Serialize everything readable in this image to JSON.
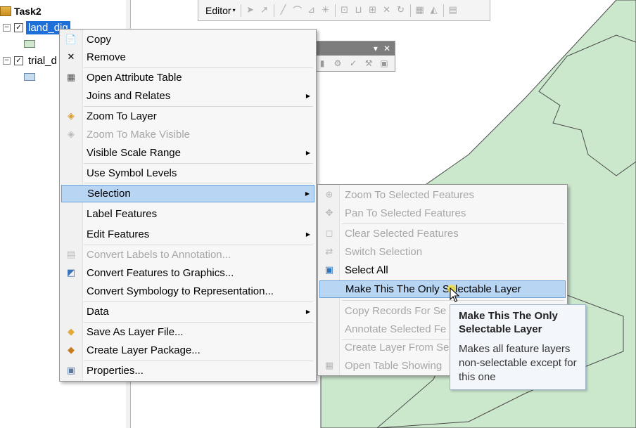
{
  "colors": {
    "map_fill": "#cbe8cd",
    "map_stroke": "#4a4a4a",
    "highlight": "#b8d6f3",
    "selected_layer": "#1e6fd9"
  },
  "toc": {
    "root": "Task2",
    "layers": [
      {
        "name": "land_dig",
        "checked": true,
        "swatch": "#cfe8cf"
      },
      {
        "name": "trial_d",
        "checked": true,
        "swatch": "#c6dcef"
      }
    ]
  },
  "editor_toolbar": {
    "label": "Editor"
  },
  "context_menu": {
    "items": [
      {
        "label": "Copy",
        "icon": "copy-icon",
        "glyph": "📄",
        "enabled": true,
        "submenu": false
      },
      {
        "label": "Remove",
        "icon": "remove-icon",
        "glyph": "✕",
        "enabled": true,
        "submenu": false
      },
      {
        "label": "Open Attribute Table",
        "icon": "table-icon",
        "glyph": "▦",
        "enabled": true,
        "submenu": false
      },
      {
        "label": "Joins and Relates",
        "icon": "",
        "glyph": "",
        "enabled": true,
        "submenu": true
      },
      {
        "label": "Zoom To Layer",
        "icon": "zoom-to-layer-icon",
        "glyph": "◈",
        "enabled": true,
        "submenu": false
      },
      {
        "label": "Zoom To Make Visible",
        "icon": "zoom-visible-icon",
        "glyph": "◈",
        "enabled": false,
        "submenu": false
      },
      {
        "label": "Visible Scale Range",
        "icon": "",
        "glyph": "",
        "enabled": true,
        "submenu": true
      },
      {
        "label": "Use Symbol Levels",
        "icon": "",
        "glyph": "",
        "enabled": true,
        "submenu": false
      },
      {
        "label": "Selection",
        "icon": "",
        "glyph": "",
        "enabled": true,
        "submenu": true,
        "highlighted": true
      },
      {
        "label": "Label Features",
        "icon": "",
        "glyph": "",
        "enabled": true,
        "submenu": false
      },
      {
        "label": "Edit Features",
        "icon": "",
        "glyph": "",
        "enabled": true,
        "submenu": true
      },
      {
        "label": "Convert Labels to Annotation...",
        "icon": "convert-labels-icon",
        "glyph": "▤",
        "enabled": false,
        "submenu": false
      },
      {
        "label": "Convert Features to Graphics...",
        "icon": "convert-graphics-icon",
        "glyph": "◩",
        "enabled": true,
        "submenu": false
      },
      {
        "label": "Convert Symbology to Representation...",
        "icon": "",
        "glyph": "",
        "enabled": true,
        "submenu": false
      },
      {
        "label": "Data",
        "icon": "",
        "glyph": "",
        "enabled": true,
        "submenu": true
      },
      {
        "label": "Save As Layer File...",
        "icon": "layer-file-icon",
        "glyph": "◆",
        "enabled": true,
        "submenu": false
      },
      {
        "label": "Create Layer Package...",
        "icon": "layer-package-icon",
        "glyph": "◆",
        "enabled": true,
        "submenu": false
      },
      {
        "label": "Properties...",
        "icon": "properties-icon",
        "glyph": "▣",
        "enabled": true,
        "submenu": false
      }
    ]
  },
  "selection_submenu": {
    "items": [
      {
        "label": "Zoom To Selected Features",
        "icon": "zoom-selected-icon",
        "glyph": "⊕",
        "enabled": false
      },
      {
        "label": "Pan To Selected Features",
        "icon": "pan-selected-icon",
        "glyph": "✥",
        "enabled": false
      },
      {
        "label": "Clear Selected Features",
        "icon": "clear-selection-icon",
        "glyph": "◻",
        "enabled": false
      },
      {
        "label": "Switch Selection",
        "icon": "switch-selection-icon",
        "glyph": "⇄",
        "enabled": false
      },
      {
        "label": "Select All",
        "icon": "select-all-icon",
        "glyph": "▣",
        "enabled": true
      },
      {
        "label": "Make This The Only Selectable Layer",
        "icon": "",
        "glyph": "",
        "enabled": true,
        "highlighted": true
      },
      {
        "label": "Copy Records For Se",
        "icon": "",
        "glyph": "",
        "enabled": false
      },
      {
        "label": "Annotate Selected Fe",
        "icon": "",
        "glyph": "",
        "enabled": false
      },
      {
        "label": "Create Layer From Se",
        "icon": "",
        "glyph": "",
        "enabled": false
      },
      {
        "label": "Open Table Showing",
        "icon": "open-table-icon",
        "glyph": "▦",
        "enabled": false
      }
    ]
  },
  "tooltip": {
    "title": "Make This The Only Selectable Layer",
    "body": "Makes all feature layers non-selectable except for this one"
  }
}
